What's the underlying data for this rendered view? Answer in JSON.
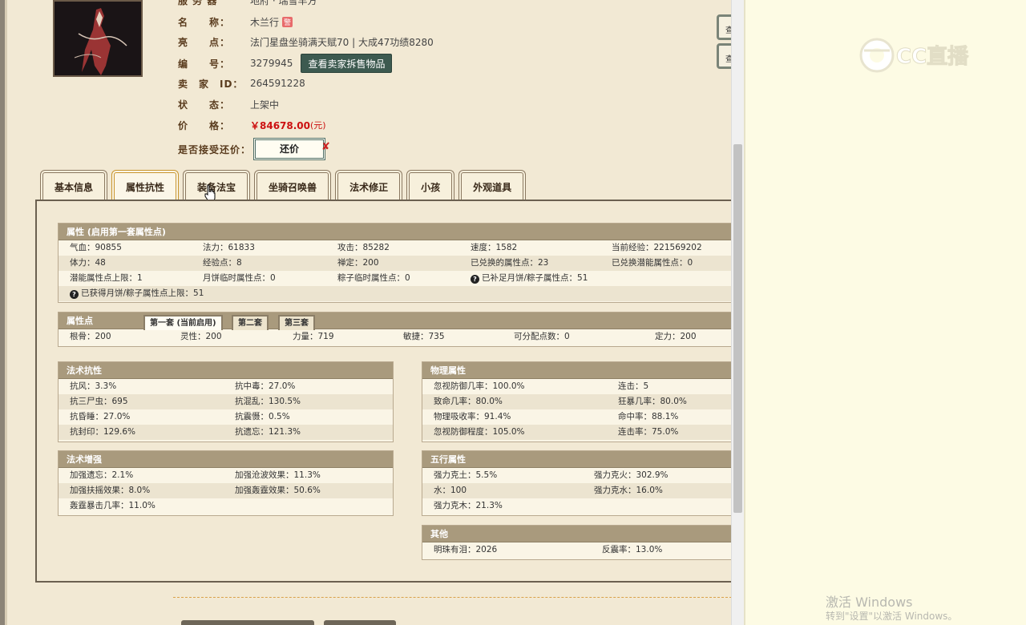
{
  "item": {
    "server_label": "服 务 器",
    "server_value": "地府 · 瑞雪丰方",
    "name_label": "名　　称：",
    "name_value": "木兰行",
    "name_tag": "警",
    "highlight_label": "亮　　点：",
    "highlight_value": "法门星盘坐骑满天赋70 | 大成47功绩8280",
    "id_label": "编　　号：",
    "id_value": "3279945",
    "view_seller_button": "查看卖家拆售物品",
    "seller_label": "卖　家　ID：",
    "seller_value": "264591228",
    "status_label": "状　　态：",
    "status_value": "上架中",
    "price_label": "价　　格：",
    "price_value": "￥84678.00",
    "price_unit": "(元)",
    "bargain_label": "是否接受还价：",
    "bargain_button": "还价",
    "bargain_mark": "✘",
    "side_button_1": "查",
    "side_button_2": "查"
  },
  "tabs": [
    {
      "label": "基本信息",
      "active": false
    },
    {
      "label": "属性抗性",
      "active": true
    },
    {
      "label": "装备法宝",
      "active": false
    },
    {
      "label": "坐骑召唤兽",
      "active": false
    },
    {
      "label": "法术修正",
      "active": false
    },
    {
      "label": "小孩",
      "active": false
    },
    {
      "label": "外观道具",
      "active": false
    }
  ],
  "attributes": {
    "title": "属性 (启用第一套属性点)",
    "rows": [
      [
        "气血：90855",
        "法力：61833",
        "攻击：85282",
        "速度：1582",
        "当前经验：221569202"
      ],
      [
        "体力：48",
        "经验点：8",
        "禅定：200",
        "已兑换的属性点：23",
        "已兑换潜能属性点：0"
      ],
      [
        "潜能属性点上限：1",
        "月饼临时属性点：0",
        "粽子临时属性点：0",
        "已补足月饼/粽子属性点：51",
        ""
      ],
      [
        "已获得月饼/粽子属性点上限：51",
        "",
        "",
        "",
        ""
      ]
    ]
  },
  "attr_points": {
    "title": "属性点",
    "set_tabs": [
      "第一套 (当前启用)",
      "第二套",
      "第三套"
    ],
    "row": [
      "根骨：200",
      "灵性：200",
      "力量：719",
      "敏捷：735",
      "可分配点数：0",
      "定力：200"
    ]
  },
  "magic_resist": {
    "title": "法术抗性",
    "rows": [
      [
        "抗风：3.3%",
        "抗中毒：27.0%"
      ],
      [
        "抗三尸虫：695",
        "抗混乱：130.5%"
      ],
      [
        "抗昏睡：27.0%",
        "抗震慑：0.5%"
      ],
      [
        "抗封印：129.6%",
        "抗遗忘：121.3%"
      ]
    ]
  },
  "magic_boost": {
    "title": "法术增强",
    "rows": [
      [
        "加强遗忘：2.1%",
        "加强沧波效果：11.3%"
      ],
      [
        "加强扶摇效果：8.0%",
        "加强轰霆效果：50.6%"
      ],
      [
        "轰霆暴击几率：11.0%",
        ""
      ]
    ]
  },
  "physical": {
    "title": "物理属性",
    "rows": [
      [
        "忽视防御几率：100.0%",
        "连击：5"
      ],
      [
        "致命几率：80.0%",
        "狂暴几率：80.0%"
      ],
      [
        "物理吸收率：91.4%",
        "命中率：88.1%"
      ],
      [
        "忽视防御程度：105.0%",
        "连击率：75.0%"
      ]
    ]
  },
  "five_elements": {
    "title": "五行属性",
    "rows": [
      [
        "强力克土：5.5%",
        "强力克火：302.9%"
      ],
      [
        "水：100",
        "强力克水：16.0%"
      ],
      [
        "强力克木：21.3%",
        ""
      ]
    ]
  },
  "other": {
    "title": "其他",
    "rows": [
      [
        "明珠有泪：2026",
        "反震率：13.0%"
      ]
    ]
  },
  "watermark": {
    "logo_text": "CC直播",
    "activate_title": "激活 Windows",
    "activate_sub": "转到\"设置\"以激活 Windows。"
  }
}
